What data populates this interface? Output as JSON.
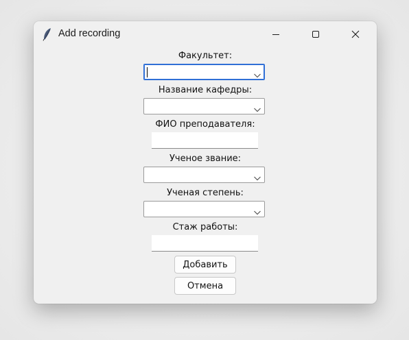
{
  "window": {
    "title": "Add recording",
    "icon": "feather-icon",
    "controls": [
      "minimize-icon",
      "maximize-icon",
      "close-icon"
    ]
  },
  "form": {
    "faculty_label": "Факультет:",
    "faculty_value": "",
    "department_label": "Название кафедры:",
    "department_value": "",
    "teacher_label": "ФИО преподавателя:",
    "teacher_value": "",
    "title_label": "Ученое звание:",
    "title_value": "",
    "degree_label": "Ученая степень:",
    "degree_value": "",
    "experience_label": "Стаж работы:",
    "experience_value": ""
  },
  "buttons": {
    "add_label": "Добавить",
    "cancel_label": "Отмена"
  },
  "colors": {
    "focus_border": "#2f6fd6",
    "window_bg": "#f0f0f0"
  }
}
